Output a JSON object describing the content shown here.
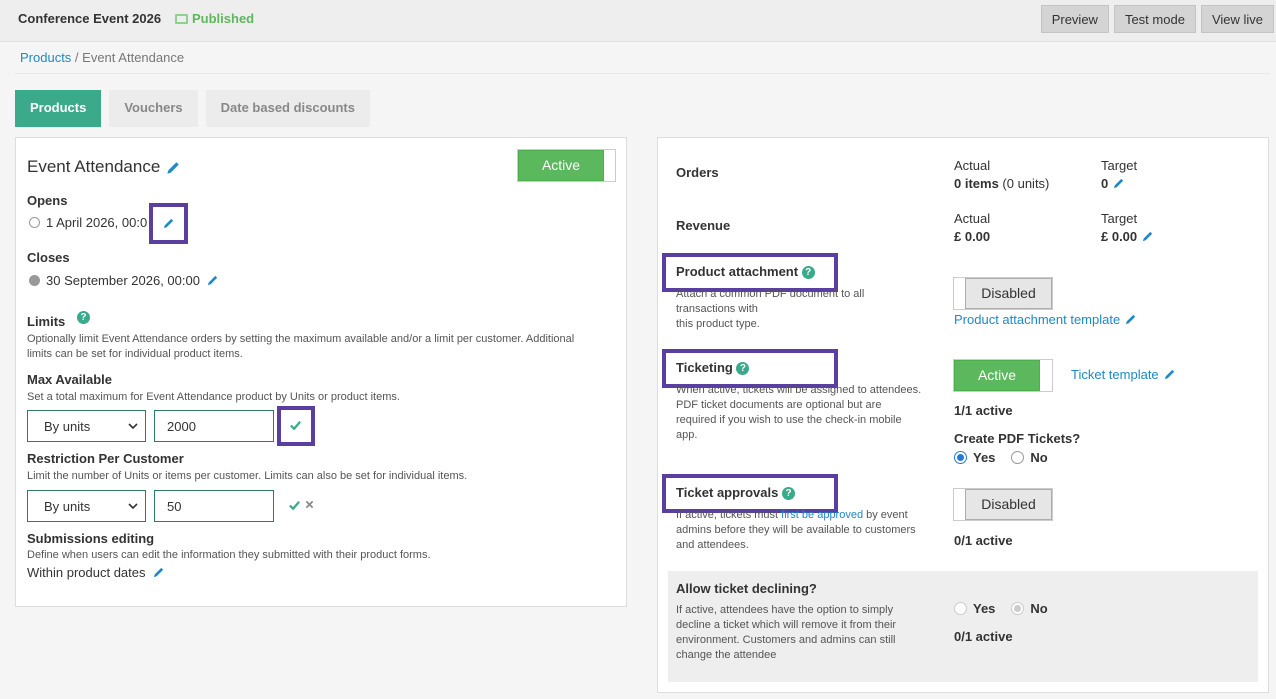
{
  "header": {
    "event_title": "Conference Event 2026",
    "status": "Published",
    "buttons": [
      "Preview",
      "Test mode",
      "View live"
    ]
  },
  "breadcrumb": {
    "root": "Products",
    "separator": " / ",
    "current": "Event Attendance"
  },
  "tabs": [
    "Products",
    "Vouchers",
    "Date based discounts"
  ],
  "left": {
    "name": "Event Attendance",
    "active_toggle": "Active",
    "opens_label": "Opens",
    "opens_value": "1 April 2026, 00:0",
    "closes_label": "Closes",
    "closes_value": "30 September 2026, 00:00",
    "limits_label": "Limits",
    "limits_desc_1": "Optionally limit Event Attendance orders by setting the maximum available and/or a limit per customer. Additional",
    "limits_desc_2": "limits can be set for individual product items.",
    "max_label": "Max Available",
    "max_desc": "Set a total maximum for Event Attendance product by Units or product items.",
    "max_select": "By units",
    "max_value": "2000",
    "restrict_label": "Restriction Per Customer",
    "restrict_desc": "Limit the number of Units or items per customer. Limits can also be set for individual items.",
    "restrict_select": "By units",
    "restrict_value": "50",
    "subm_label": "Submissions editing",
    "subm_desc": "Define when users can edit the information they submitted with their product forms.",
    "subm_value": "Within product dates"
  },
  "right": {
    "orders_label": "Orders",
    "actual_label": "Actual",
    "target_label": "Target",
    "orders_actual_bold": "0 items",
    "orders_actual_rest": " (0 units)",
    "orders_target": "0",
    "revenue_label": "Revenue",
    "revenue_actual": "£ 0.00",
    "revenue_target": "£ 0.00",
    "attach_label": "Product attachment",
    "attach_desc_1": "Attach a common PDF document to all",
    "attach_desc_2": "transactions with",
    "attach_desc_3": "this product type.",
    "attach_toggle": "Disabled",
    "attach_link": "Product attachment template",
    "ticket_label": "Ticketing",
    "ticket_desc_1": "When active, tickets will be assigned to attendees.",
    "ticket_desc_2": "PDF ticket documents are optional but are",
    "ticket_desc_3": "required if you wish to use the check-in mobile",
    "ticket_desc_4": "app.",
    "ticket_toggle": "Active",
    "ticket_link": "Ticket template",
    "ticket_count": "1/1 active",
    "pdf_label": "Create PDF Tickets?",
    "yes": "Yes",
    "no": "No",
    "approve_label": "Ticket approvals",
    "approve_desc_1a": "If active, tickets must ",
    "approve_desc_1link": "first be approved",
    "approve_desc_1b": " by event",
    "approve_desc_2": "admins before they will be available to customers",
    "approve_desc_3": "and attendees.",
    "approve_toggle": "Disabled",
    "approve_count": "0/1 active",
    "decline_label": "Allow ticket declining?",
    "decline_desc_1": "If active, attendees have the option to simply",
    "decline_desc_2": "decline a ticket which will remove it from their",
    "decline_desc_3": "environment. Customers and admins can still",
    "decline_desc_4": "change the attendee",
    "decline_count": "0/1 active"
  },
  "colors": {
    "accent": "#3aaa8a",
    "active_green": "#5cb85c",
    "link": "#1e88c8",
    "highlight": "#5b3fa0"
  },
  "icons": [
    "monitor-icon",
    "pencil-icon",
    "help-icon",
    "check-icon",
    "cross-icon",
    "caret-down-icon"
  ]
}
